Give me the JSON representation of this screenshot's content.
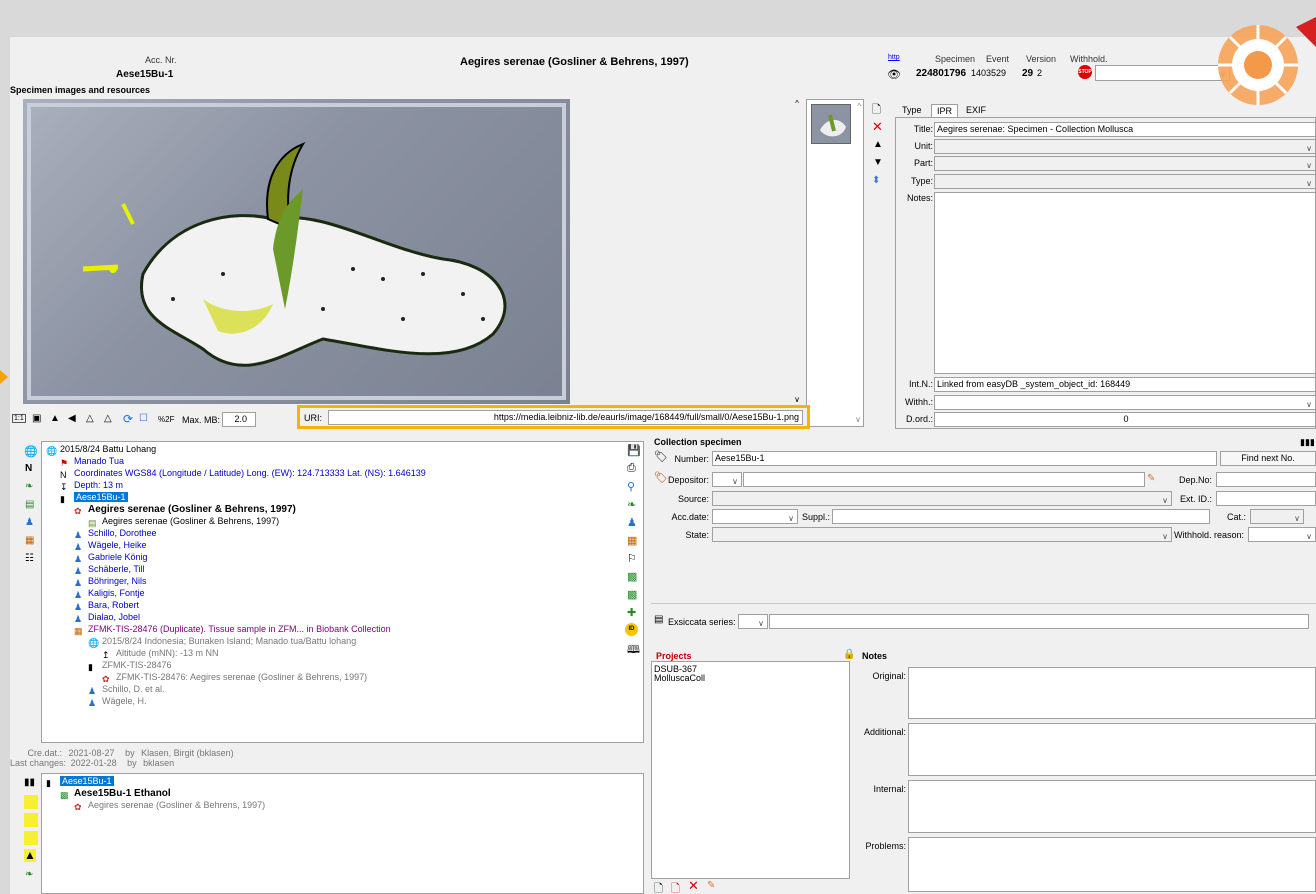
{
  "header": {
    "acc_label": "Acc. Nr.",
    "acc_value": "Aese15Bu-1",
    "title": "Aegires serenae (Gosliner & Behrens, 1997)",
    "http_link": "http",
    "specimen_label": "Specimen",
    "event_label": "Event",
    "version_label": "Version",
    "withhold_label": "Withhold.",
    "specimen_value": "224801796",
    "event_value": "1403529",
    "version_value": "29",
    "version_sub": "2",
    "stop_badge": "STOP"
  },
  "images_section": {
    "title": "Specimen images and resources",
    "toolbar": {
      "one_to_one": "1:1",
      "percent_label": "%2F",
      "max_mb_label": "Max. MB:",
      "max_mb_value": "2.0",
      "uri_label": "URI:",
      "uri_value": "https://media.leibniz-lib.de/eaurls/image/168449/full/small/0/Aese15Bu-1.png"
    }
  },
  "image_props": {
    "tabs": [
      "Type",
      "IPR",
      "EXIF"
    ],
    "title_label": "Title:",
    "title_value": "Aegires serenae: Specimen - Collection Mollusca",
    "unit_label": "Unit:",
    "part_label": "Part:",
    "type_label": "Type:",
    "notes_label": "Notes:",
    "intn_label": "Int.N.:",
    "intn_value": "Linked from easyDB _system_object_id: 168449",
    "withh_label": "Withh.:",
    "dord_label": "D.ord.:",
    "dord_value": "0"
  },
  "tree": {
    "rows": [
      {
        "text": "2015/8/24 Battu Lohang",
        "cls": "",
        "icon": "globe-icon"
      },
      {
        "text": "Manado Tua",
        "cls": "blue",
        "icon": "location-icon"
      },
      {
        "text": "Coordinates WGS84 (Longitude / Latitude) Long. (EW): 124.713333 Lat. (NS): 1.646139",
        "cls": "blue",
        "icon": "compass-icon"
      },
      {
        "text": "Depth: 13 m",
        "cls": "blue",
        "icon": "depth-icon"
      },
      {
        "text": "Aese15Bu-1",
        "cls": "sel",
        "icon": "barcode-icon"
      },
      {
        "text": "Aegires serenae (Gosliner & Behrens, 1997)",
        "cls": "bold",
        "icon": "species-icon"
      },
      {
        "text": "Aegires serenae (Gosliner & Behrens, 1997)",
        "cls": "",
        "icon": "document-icon"
      },
      {
        "text": "Schillo, Dorothee",
        "cls": "blue",
        "icon": "person-icon"
      },
      {
        "text": "Wägele, Heike",
        "cls": "blue",
        "icon": "person-icon"
      },
      {
        "text": "Gabriele König",
        "cls": "blue",
        "icon": "person-icon"
      },
      {
        "text": "Schäberle, Till",
        "cls": "blue",
        "icon": "person-icon"
      },
      {
        "text": "Böhringer, Nils",
        "cls": "blue",
        "icon": "person-icon"
      },
      {
        "text": "Kaligis, Fontje",
        "cls": "blue",
        "icon": "person-icon"
      },
      {
        "text": "Bara, Robert",
        "cls": "blue",
        "icon": "person-icon"
      },
      {
        "text": "Dialao, Jobel",
        "cls": "blue",
        "icon": "person-icon"
      },
      {
        "text": "ZFMK-TIS-28476 (Duplicate). Tissue sample in ZFM... in Biobank Collection",
        "cls": "purple",
        "icon": "duplicate-icon"
      },
      {
        "text": "2015/8/24 Indonesia; Bunaken Island; Manado tua/Battu lohang",
        "cls": "grey-t",
        "icon": "globe-icon"
      },
      {
        "text": "Altitude (mNN): -13 m NN",
        "cls": "grey-t",
        "icon": "altitude-icon"
      },
      {
        "text": "ZFMK-TIS-28476",
        "cls": "grey-t",
        "icon": "barcode-icon"
      },
      {
        "text": "ZFMK-TIS-28476: Aegires serenae (Gosliner & Behrens, 1997)",
        "cls": "grey-t",
        "icon": "species-icon"
      },
      {
        "text": "Schillo, D. et al.",
        "cls": "grey-t",
        "icon": "person-icon"
      },
      {
        "text": "Wägele, H.",
        "cls": "grey-t",
        "icon": "person-icon"
      }
    ],
    "cre_dat_label": "Cre.dat.:",
    "cre_dat_value": "2021-08-27",
    "by1": "by",
    "cre_by": "Klasen, Birgit (bklasen)",
    "last_changes_label": "Last changes:",
    "last_changes_value": "2022-01-28",
    "by2": "by",
    "last_by": "bklasen"
  },
  "parts_tree": {
    "rows": [
      {
        "text": "Aese15Bu-1",
        "cls": "sel",
        "icon": "barcode-icon"
      },
      {
        "text": "Aese15Bu-1 Ethanol",
        "cls": "bold",
        "icon": "jar-icon"
      },
      {
        "text": "Aegires serenae (Gosliner & Behrens, 1997)",
        "cls": "grey-t",
        "icon": "species-icon"
      }
    ]
  },
  "collection_specimen": {
    "title": "Collection specimen",
    "number_label": "Number:",
    "number_value": "Aese15Bu-1",
    "find_next_label": "Find next No.",
    "depositor_label": "Depositor:",
    "depno_label": "Dep.No:",
    "source_label": "Source:",
    "extid_label": "Ext. ID.:",
    "accdate_label": "Acc.date:",
    "suppl_label": "Suppl.:",
    "cat_label": "Cat.:",
    "state_label": "State:",
    "withhold_reason_label": "Withhold. reason:",
    "exsiccata_label": "Exsiccata series:"
  },
  "projects": {
    "title": "Projects",
    "items": [
      "DSUB-367",
      "MolluscaColl"
    ]
  },
  "notes": {
    "title": "Notes",
    "original_label": "Original:",
    "additional_label": "Additional:",
    "internal_label": "Internal:",
    "problems_label": "Problems:"
  }
}
